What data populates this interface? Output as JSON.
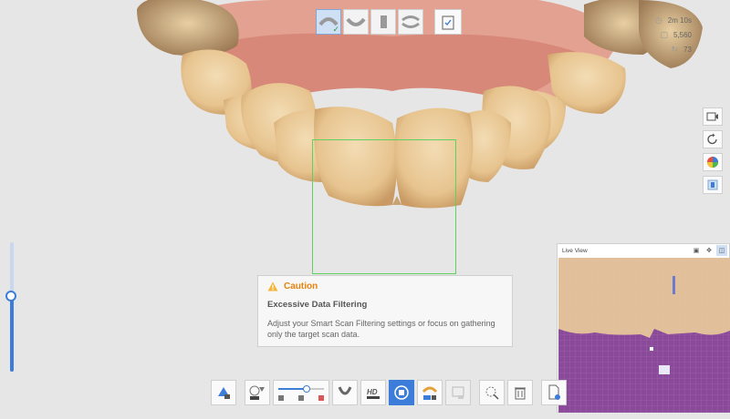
{
  "stats": {
    "time": "2m 10s",
    "count": "5,560",
    "value": "73"
  },
  "caution": {
    "title": "Caution",
    "subtitle": "Excessive Data Filtering",
    "message": "Adjust your Smart Scan Filtering settings or focus on gathering only the target scan data."
  },
  "live_view": {
    "title": "Live View"
  },
  "colors": {
    "accent": "#3b7dd8",
    "caution": "#e8820c",
    "roi": "#5fd15f",
    "background": "#e6e6e6"
  },
  "scan_progress": {
    "current_step": 1,
    "steps_total": 4
  },
  "scan_filter_level": 0.55,
  "icons": {
    "top_steps": [
      "maxilla-step-icon",
      "mandible-step-icon",
      "die-step-icon",
      "occlusion-step-icon",
      "review-step-icon"
    ],
    "right_tools": [
      "record-icon",
      "reset-icon",
      "color-icon",
      "shade-icon"
    ],
    "bottom_tools": [
      "scan-filter-icon",
      "smart-scan-filter-icon",
      "filter-level-slider",
      "arch-icon",
      "hd-icon",
      "stop-icon",
      "ai-scan-icon",
      "disabled-tool-icon",
      "lasso-icon",
      "trash-icon",
      "export-icon"
    ]
  }
}
